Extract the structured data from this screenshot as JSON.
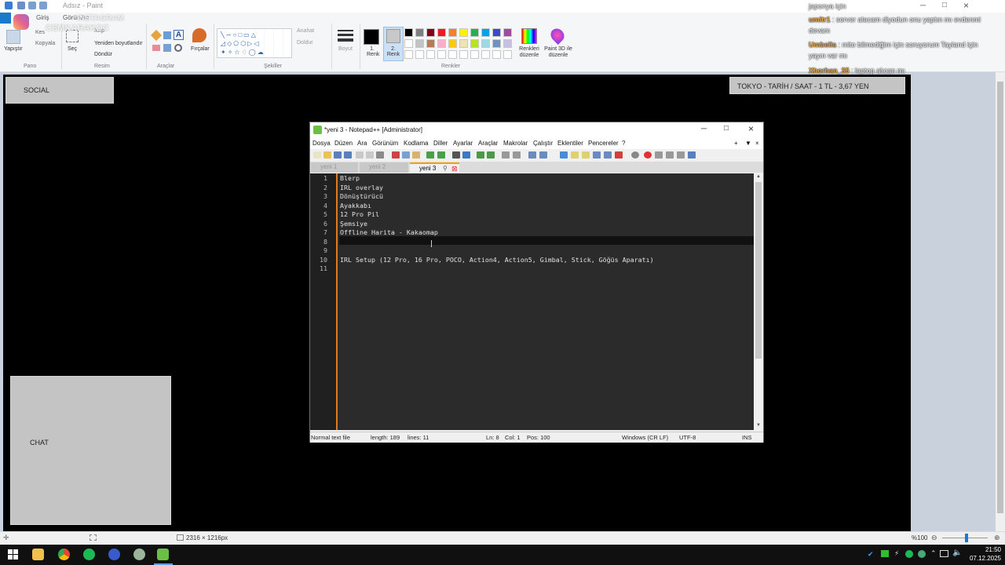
{
  "paint": {
    "title": "Adsız - Paint",
    "tabs": [
      "Giriş",
      "Görünüm"
    ],
    "groups": {
      "clipboard": {
        "label": "Pano",
        "paste": "Yapıştır",
        "cut": "Kes",
        "copy": "Kopyala"
      },
      "image": {
        "label": "Resim",
        "select": "Seç",
        "crop": "Kırp",
        "resize": "Yeniden boyutlandır",
        "rotate": "Döndür"
      },
      "tools": {
        "label": "Araçlar"
      },
      "brushes": {
        "label": "Fırçalar"
      },
      "shapes": {
        "label": "Şekiller",
        "outline": "Anahat",
        "fill": "Doldur"
      },
      "size": {
        "label": "Boyut"
      },
      "colors": {
        "label": "Renkler",
        "color1": "1. Renk",
        "color2": "2. Renk",
        "edit": "Renkleri düzenle",
        "palette_row1": [
          "#000000",
          "#7f7f7f",
          "#880015",
          "#ed1c24",
          "#ff7f27",
          "#fff200",
          "#22b14c",
          "#00a2e8",
          "#3f48cc",
          "#a349a4"
        ],
        "palette_row2": [
          "#ffffff",
          "#c3c3c3",
          "#b97a57",
          "#ffaec9",
          "#ffc90e",
          "#efe4b0",
          "#b5e61d",
          "#99d9ea",
          "#7092be",
          "#c8bfe7"
        ]
      },
      "paint3d": {
        "label": "Paint 3D ile düzenle"
      }
    },
    "status": {
      "dimensions": "2316 × 1216px",
      "zoom": "%100"
    }
  },
  "overlay": {
    "instagram": "INSTAGRAM",
    "instagram_handle": "CEMKARAKOC",
    "social": "SOCIAL",
    "tokyo": "TOKYO - TARİH / SAAT - 1 TL - 3,67 YEN",
    "chat": "CHAT",
    "chat_messages": [
      {
        "user": "",
        "text": "japonya için"
      },
      {
        "user": "umitr1",
        "text": ": server alacam diyodun onu yaptın mı evdenmi"
      },
      {
        "user": "",
        "text": "devam"
      },
      {
        "user": "Umbella",
        "text": ": mito bilmediğim için soruyorum Tayland için"
      },
      {
        "user": "",
        "text": "yayın var mı"
      },
      {
        "user": "Xhorhan_35",
        "text": ": laptop alıcan mı"
      }
    ]
  },
  "notepad": {
    "title": "*yeni 3 - Notepad++ [Administrator]",
    "menu": [
      "Dosya",
      "Düzen",
      "Ara",
      "Görünüm",
      "Kodlama",
      "Diller",
      "Ayarlar",
      "Araçlar",
      "Makrolar",
      "Çalıştır",
      "Eklentiler",
      "Pencereler",
      "?"
    ],
    "tabs": [
      "yeni 1",
      "yeni 2",
      "yeni 3"
    ],
    "active_tab": "yeni 3",
    "lines": [
      "Blerp",
      "IRL overlay",
      "Dönüştürücü",
      "Ayakkabı",
      "12 Pro Pil",
      "Şemsiye",
      "Offline Harita - Kakaomap",
      "",
      "",
      "IRL Setup (12 Pro, 16 Pro, POCO, Action4, Action5, Gimbal, Stick, Göğüs Aparatı)",
      ""
    ],
    "line_numbers": [
      "1",
      "2",
      "3",
      "4",
      "5",
      "6",
      "7",
      "8",
      "9",
      "10",
      "11"
    ],
    "status": {
      "type": "Normal text file",
      "length": "length: 189",
      "lines": "lines: 11",
      "ln": "Ln: 8",
      "col": "Col: 1",
      "pos": "Pos: 100",
      "eol": "Windows (CR LF)",
      "encoding": "UTF-8",
      "mode": "INS"
    }
  },
  "taskbar": {
    "time": "21:50",
    "date": "07.12.2025"
  }
}
